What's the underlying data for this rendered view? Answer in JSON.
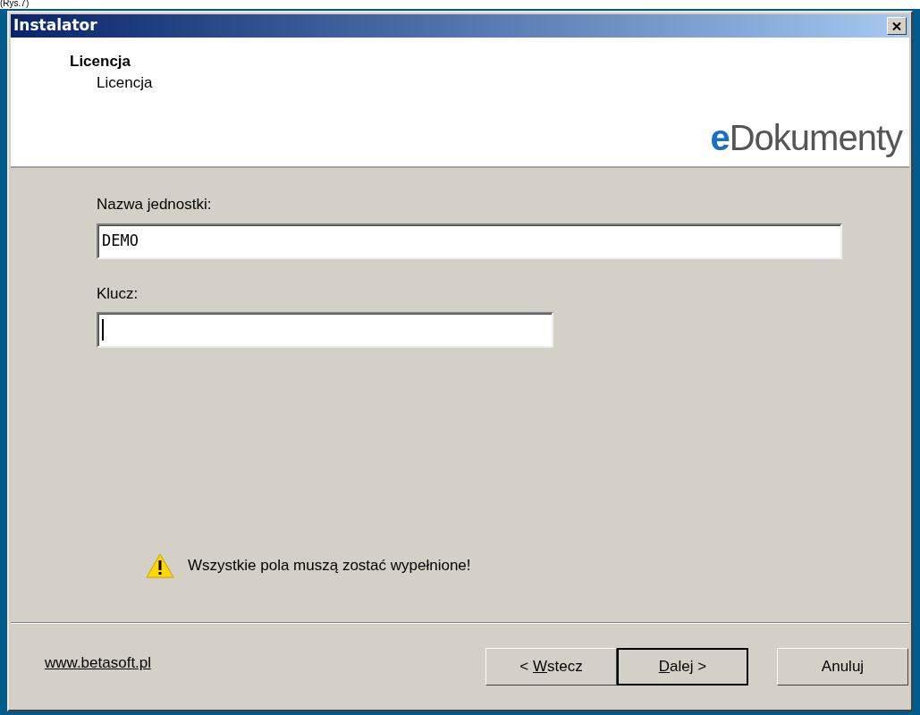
{
  "caption": "(Rys.7)",
  "window": {
    "title": "Instalator"
  },
  "header": {
    "title": "Licencja",
    "subtitle": "Licencja",
    "logo": {
      "accent": "e",
      "rest": "Dokumenty"
    }
  },
  "fields": [
    {
      "label": "Nazwa jednostki:",
      "value": "DEMO",
      "focused": false,
      "wide": true
    },
    {
      "label": "Klucz:",
      "focused": true,
      "wide": false
    }
  ],
  "warning": "Wszystkie pola muszą zostać wypełnione!",
  "footer": {
    "link": "www.betasoft.pl",
    "buttons": [
      {
        "before": "< ",
        "mnemonic": "W",
        "after": "stecz",
        "default": false
      },
      {
        "mnemonic": "D",
        "after": "alej >",
        "default": true
      },
      {
        "before": "Anuluj",
        "default": false
      }
    ]
  }
}
